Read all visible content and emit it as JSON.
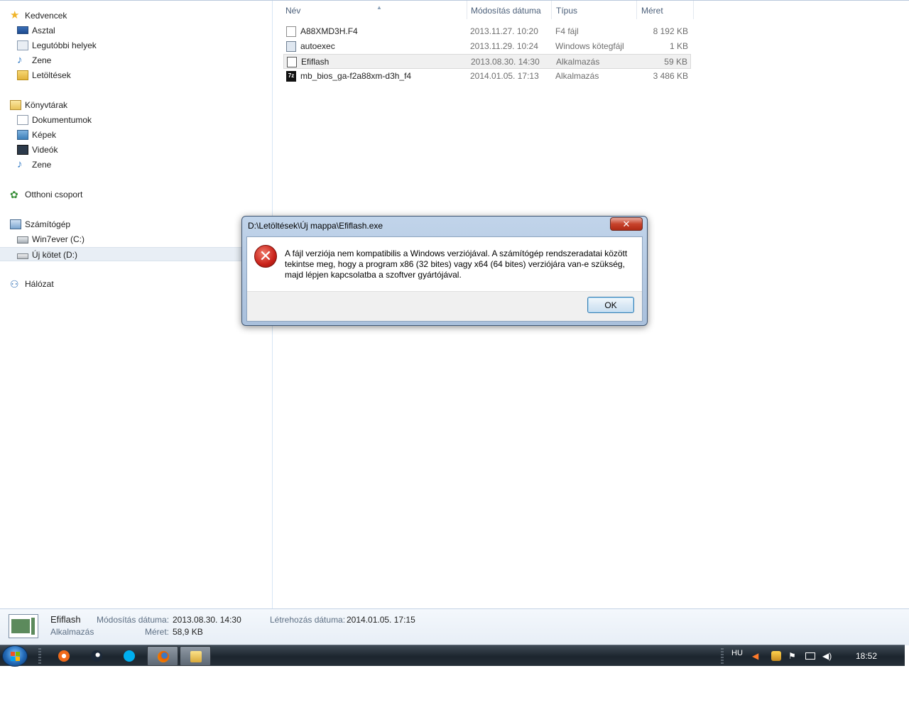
{
  "nav": {
    "favorites_header": "Kedvencek",
    "favorites": [
      "Asztal",
      "Legutóbbi helyek",
      "Zene",
      "Letöltések"
    ],
    "libraries_header": "Könyvtárak",
    "libraries": [
      "Dokumentumok",
      "Képek",
      "Videók",
      "Zene"
    ],
    "homegroup": "Otthoni csoport",
    "computer_header": "Számítógép",
    "drives": [
      "Win7ever (C:)",
      "Új kötet (D:)"
    ],
    "network": "Hálózat"
  },
  "columns": {
    "name": "Név",
    "modified": "Módosítás dátuma",
    "type": "Típus",
    "size": "Méret"
  },
  "files": [
    {
      "name": "A88XMD3H.F4",
      "modified": "2013.11.27. 10:20",
      "type": "F4 fájl",
      "size": "8 192 KB",
      "icon": "file-icon"
    },
    {
      "name": "autoexec",
      "modified": "2013.11.29. 10:24",
      "type": "Windows kötegfájl",
      "size": "1 KB",
      "icon": "batch-file-icon"
    },
    {
      "name": "Efiflash",
      "modified": "2013.08.30. 14:30",
      "type": "Alkalmazás",
      "size": "59 KB",
      "icon": "application-icon"
    },
    {
      "name": "mb_bios_ga-f2a88xm-d3h_f4",
      "modified": "2014.01.05. 17:13",
      "type": "Alkalmazás",
      "size": "3 486 KB",
      "icon": "7zip-icon"
    }
  ],
  "icon_7z": "7z",
  "details": {
    "name": "Efiflash",
    "type": "Alkalmazás",
    "modified_label": "Módosítás dátuma:",
    "modified_value": "2013.08.30. 14:30",
    "size_label": "Méret:",
    "size_value": "58,9 KB",
    "created_label": "Létrehozás dátuma:",
    "created_value": "2014.01.05. 17:15"
  },
  "dialog": {
    "title": "D:\\Letöltések\\Új mappa\\Efiflash.exe",
    "message": "A fájl verziója nem kompatibilis a Windows verziójával. A számítógép rendszeradatai között tekintse meg, hogy a program x86 (32 bites) vagy x64 (64 bites) verziójára van-e szükség, majd lépjen kapcsolatba a szoftver gyártójával.",
    "ok_label": "OK",
    "close_glyph": "✕",
    "error_glyph": "✕"
  },
  "taskbar": {
    "apps": [
      "origin-icon",
      "steam-icon",
      "skype-icon",
      "firefox-icon",
      "explorer-icon"
    ],
    "language": "HU",
    "clock": "18:52"
  },
  "colors": {
    "nav_selected": "#e8eef5",
    "dialog_frame": "#b3c8e2",
    "error_red": "#c9221a",
    "taskbar": "#1c252e"
  }
}
